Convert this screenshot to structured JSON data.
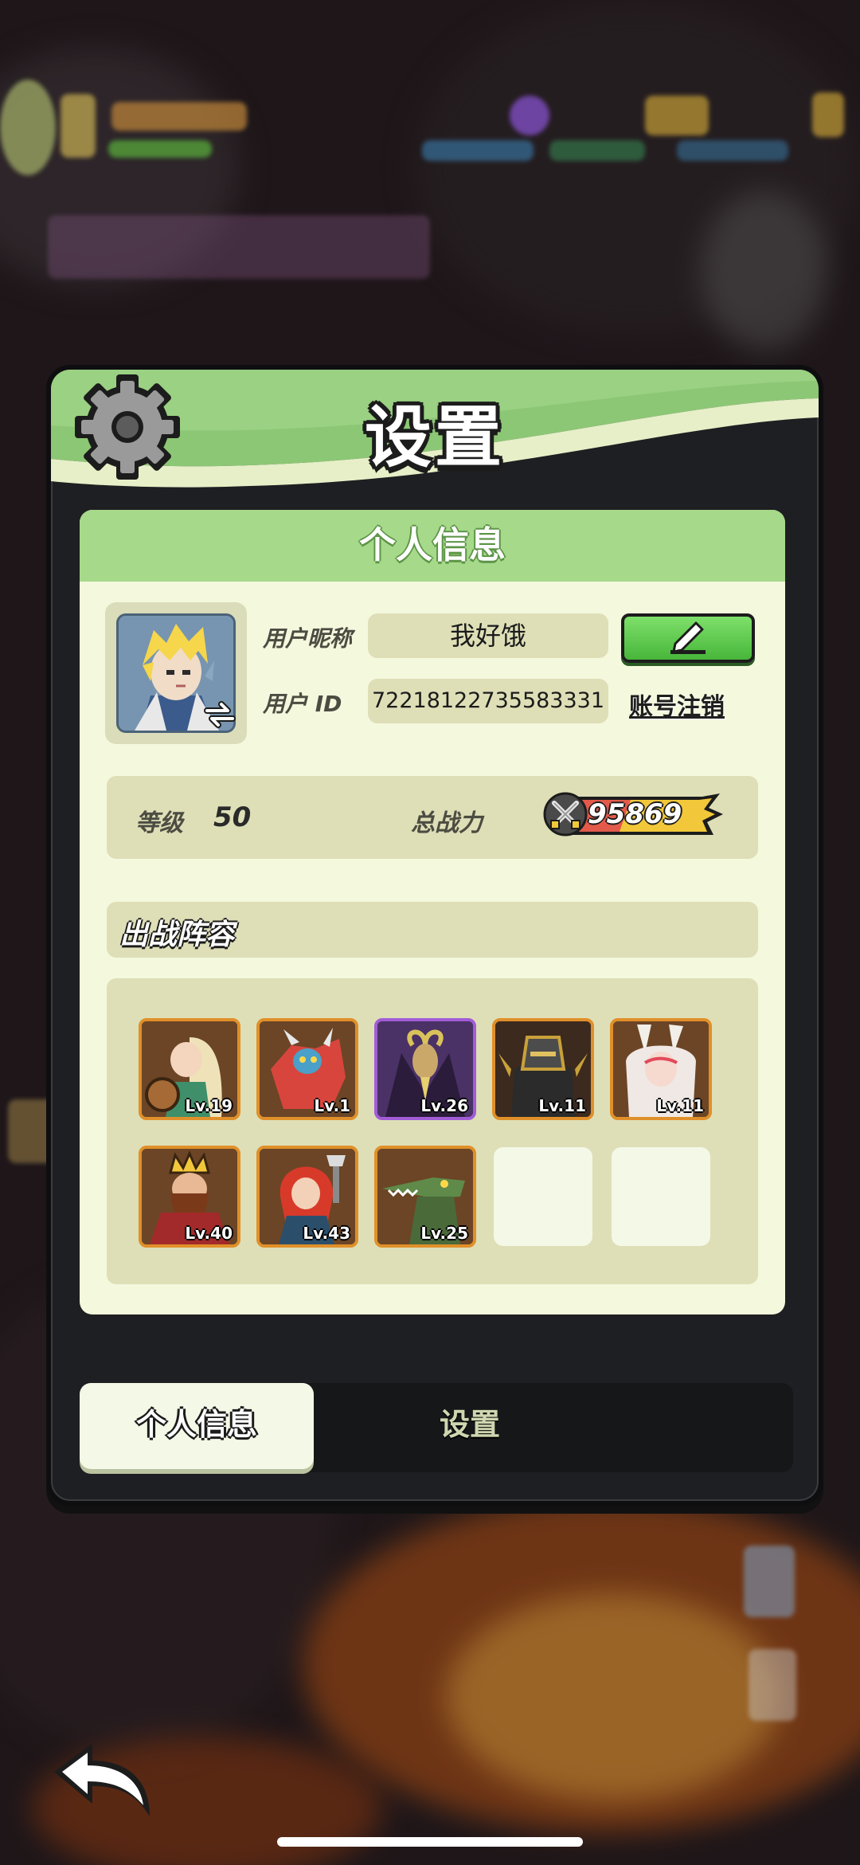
{
  "modal": {
    "title": "设置",
    "panel_title": "个人信息"
  },
  "profile": {
    "nickname_label": "用户昵称",
    "nickname_value": "我好饿",
    "id_label": "用户 ID",
    "id_value": "72218122735583331",
    "cancel_account_label": "账号注销",
    "level_label": "等级",
    "level_value": "50",
    "power_label": "总战力",
    "power_value": "95869"
  },
  "lineup": {
    "title": "出战阵容",
    "heroes": [
      {
        "level": "Lv.19",
        "frame": "gold"
      },
      {
        "level": "Lv.1",
        "frame": "gold"
      },
      {
        "level": "Lv.26",
        "frame": "purple"
      },
      {
        "level": "Lv.11",
        "frame": "gold"
      },
      {
        "level": "Lv.11",
        "frame": "gold"
      },
      {
        "level": "Lv.40",
        "frame": "gold"
      },
      {
        "level": "Lv.43",
        "frame": "gold"
      },
      {
        "level": "Lv.25",
        "frame": "gold"
      }
    ],
    "empty_slots": 2
  },
  "tabs": {
    "active": "个人信息",
    "inactive": "设置"
  },
  "icons": {
    "header": "gear-icon",
    "edit": "pencil-icon",
    "power": "crossed-swords-icon",
    "back": "back-arrow-icon",
    "avatar_swap": "swap-arrows-icon"
  },
  "colors": {
    "header_green": "#8cc775",
    "panel_bg": "#f4f8dd",
    "accent_gold": "#f2c83a",
    "edit_green": "#5ccb47"
  }
}
